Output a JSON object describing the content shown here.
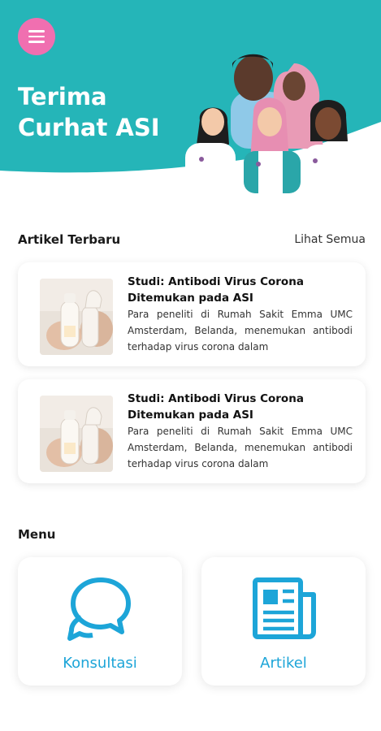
{
  "header": {
    "title_line1": "Terima",
    "title_line2": "Curhat ASI",
    "brand_color": "#25b5b8",
    "menu_button_color": "#f06fb0",
    "menu_icon": "hamburger-icon"
  },
  "articles": {
    "heading": "Artikel Terbaru",
    "see_all": "Lihat Semua",
    "items": [
      {
        "title": "Studi: Antibodi Virus Corona Ditemukan pada ASI",
        "excerpt": "Para peneliti di Rumah Sakit Emma UMC Amsterdam, Belanda, menemukan antibodi terhadap virus corona dalam"
      },
      {
        "title": "Studi: Antibodi Virus Corona Ditemukan pada ASI",
        "excerpt": "Para peneliti di Rumah Sakit Emma UMC Amsterdam, Belanda, menemukan antibodi terhadap virus corona dalam"
      }
    ]
  },
  "menu": {
    "heading": "Menu",
    "accent_color": "#1da5d8",
    "items": [
      {
        "label": "Konsultasi",
        "icon": "chat-bubbles-icon"
      },
      {
        "label": "Artikel",
        "icon": "newspaper-icon"
      }
    ]
  }
}
